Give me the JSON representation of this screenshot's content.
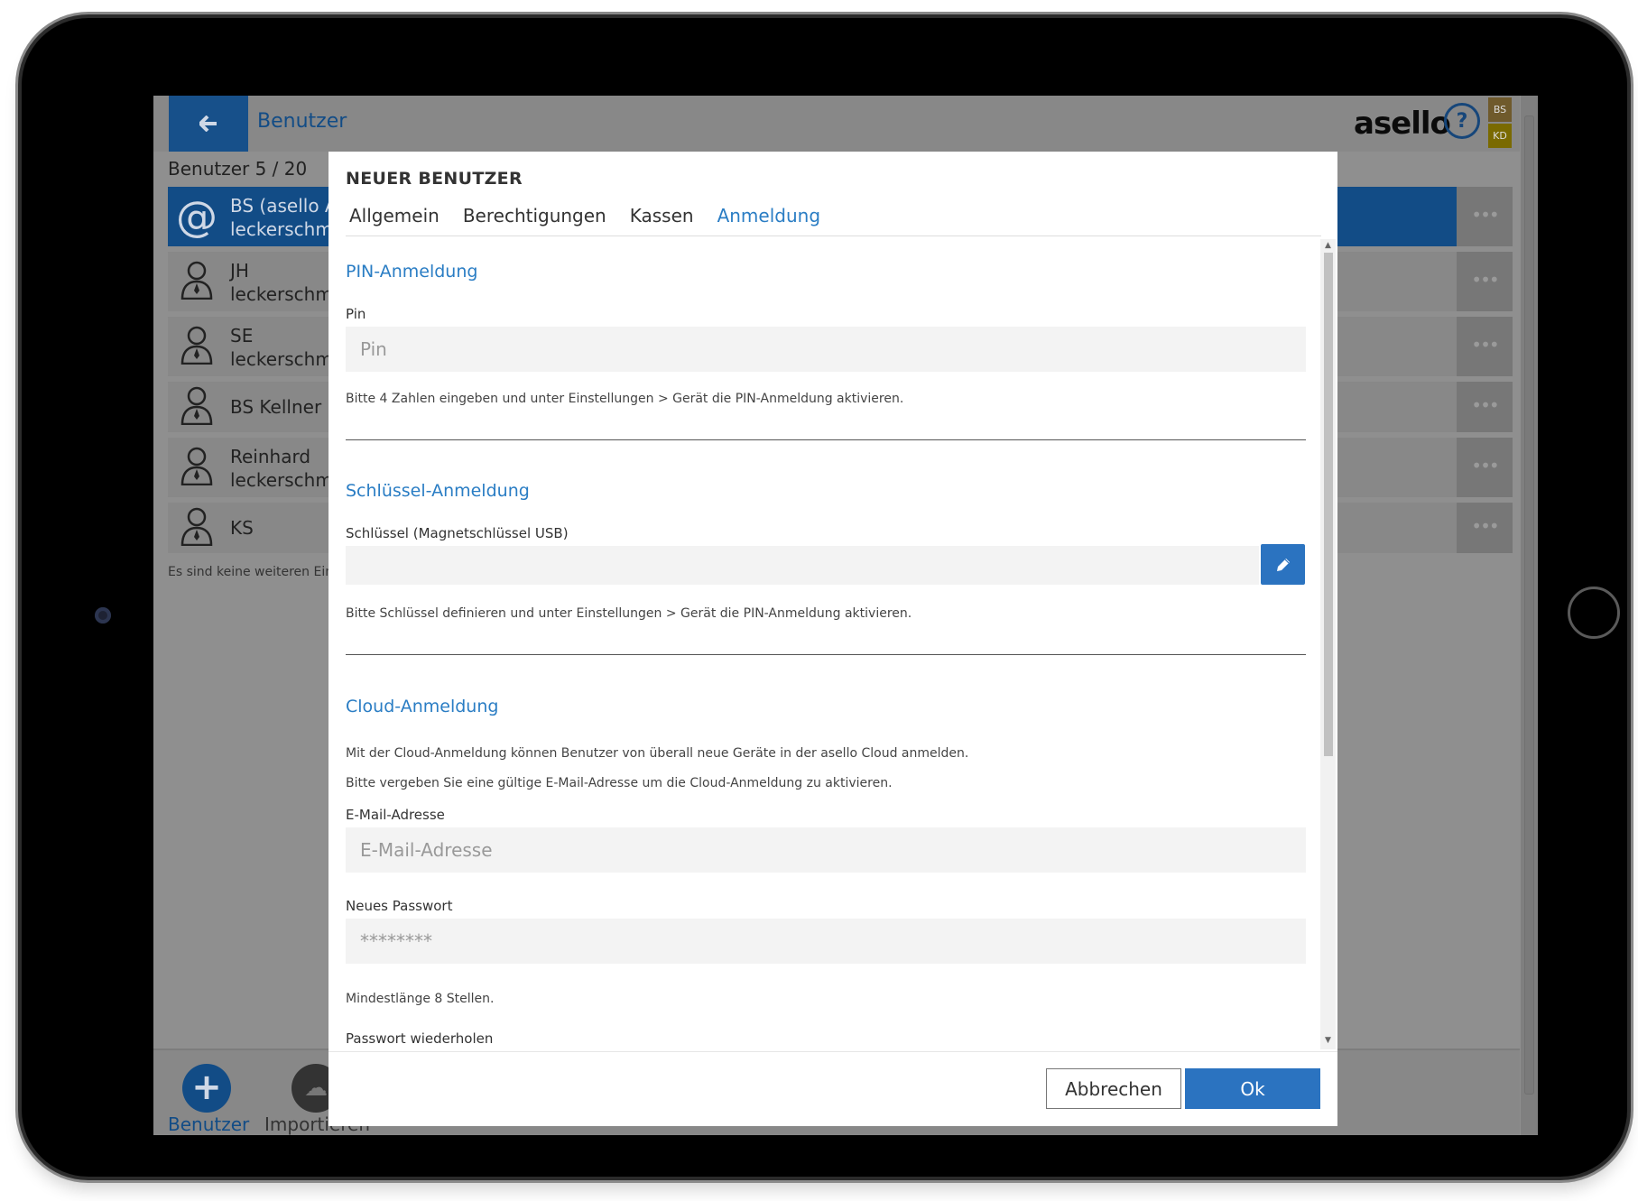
{
  "header": {
    "title": "Benutzer",
    "logo": "asello",
    "help_symbol": "?",
    "badges": [
      "BS",
      "KD"
    ],
    "back_icon": "arrow-left-icon"
  },
  "user_list": {
    "count_label": "Benutzer 5 / 20",
    "users": [
      {
        "name": "BS (asello A",
        "sub": "leckerschme",
        "icon": "at-icon",
        "active": true
      },
      {
        "name": "JH",
        "sub": "leckerschme",
        "icon": "user-icon"
      },
      {
        "name": "SE",
        "sub": "leckerschme",
        "icon": "user-icon"
      },
      {
        "name": "BS Kellner",
        "sub": "",
        "icon": "user-icon"
      },
      {
        "name": "Reinhard",
        "sub": "leckerschme",
        "icon": "user-icon"
      },
      {
        "name": "KS",
        "sub": "",
        "icon": "user-icon"
      }
    ],
    "more_label": "•••",
    "footnote": "Es sind keine weiteren Ein"
  },
  "bottom_bar": {
    "add_label": "Benutzer",
    "import_label": "Importieren"
  },
  "modal": {
    "title": "NEUER BENUTZER",
    "tabs": [
      {
        "label": "Allgemein",
        "active": false
      },
      {
        "label": "Berechtigungen",
        "active": false
      },
      {
        "label": "Kassen",
        "active": false
      },
      {
        "label": "Anmeldung",
        "active": true
      }
    ],
    "pin": {
      "section_title": "PIN-Anmeldung",
      "label": "Pin",
      "placeholder": "Pin",
      "value": "",
      "hint": "Bitte 4 Zahlen eingeben und unter Einstellungen > Gerät die PIN-Anmeldung aktivieren."
    },
    "key": {
      "section_title": "Schlüssel-Anmeldung",
      "label": "Schlüssel (Magnetschlüssel USB)",
      "value": "",
      "edit_icon": "pencil-icon",
      "hint": "Bitte Schlüssel definieren und unter Einstellungen > Gerät die PIN-Anmeldung aktivieren."
    },
    "cloud": {
      "section_title": "Cloud-Anmeldung",
      "text1": "Mit der Cloud-Anmeldung können Benutzer von überall neue Geräte in der asello Cloud anmelden.",
      "text2": "Bitte vergeben Sie eine gültige E-Mail-Adresse um die Cloud-Anmeldung zu aktivieren.",
      "email_label": "E-Mail-Adresse",
      "email_placeholder": "E-Mail-Adresse",
      "password_label": "Neues Passwort",
      "password_placeholder": "********",
      "password_hint": "Mindestlänge 8 Stellen.",
      "repeat_label": "Passwort wiederholen"
    },
    "cancel_label": "Abbrechen",
    "ok_label": "Ok"
  },
  "colors": {
    "primary": "#2b73c0",
    "dark_primary": "#124c86",
    "section_title": "#2a7dc4",
    "overlay_bg": "#8f8f8f"
  }
}
